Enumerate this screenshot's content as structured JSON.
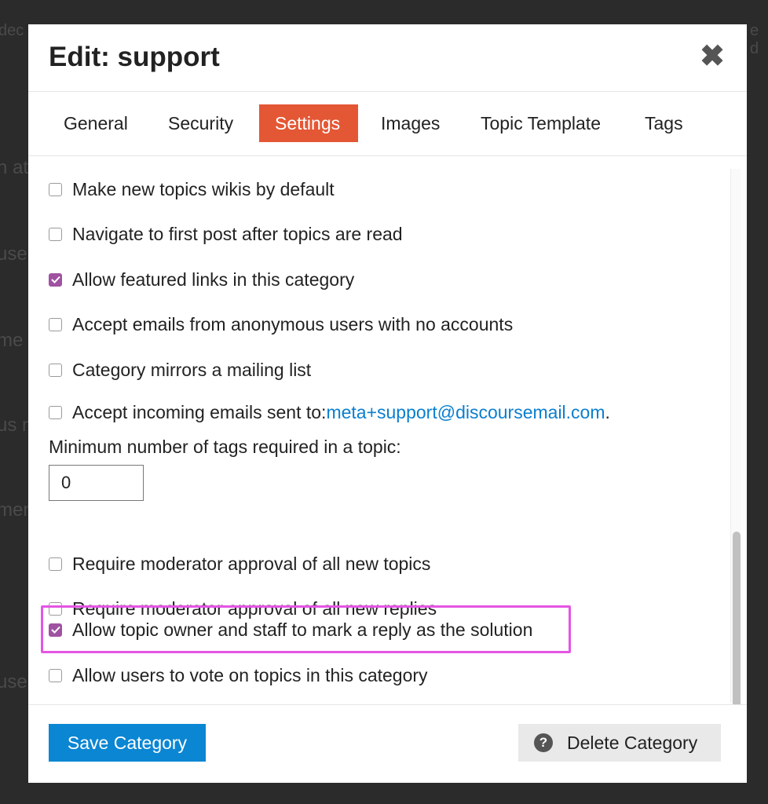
{
  "modal": {
    "title": "Edit: support",
    "close_glyph": "✖"
  },
  "tabs": [
    {
      "label": "General",
      "active": false
    },
    {
      "label": "Security",
      "active": false
    },
    {
      "label": "Settings",
      "active": true
    },
    {
      "label": "Images",
      "active": false
    },
    {
      "label": "Topic Template",
      "active": false
    },
    {
      "label": "Tags",
      "active": false
    }
  ],
  "settings": {
    "options": [
      {
        "label": "Make new topics wikis by default",
        "checked": false
      },
      {
        "label": "Navigate to first post after topics are read",
        "checked": false
      },
      {
        "label": "Allow featured links in this category",
        "checked": true
      },
      {
        "label": "Accept emails from anonymous users with no accounts",
        "checked": false
      },
      {
        "label": "Category mirrors a mailing list",
        "checked": false
      },
      {
        "label": "Accept incoming emails sent to:",
        "checked": false,
        "link": "meta+support@discoursemail.com",
        "suffix": "."
      },
      {
        "label": "Require moderator approval of all new topics",
        "checked": false
      },
      {
        "label": "Require moderator approval of all new replies",
        "checked": false
      },
      {
        "label": "Allow topic owner and staff to mark a reply as the solution",
        "checked": true,
        "highlighted": true
      },
      {
        "label": "Allow users to vote on topics in this category",
        "checked": false
      }
    ],
    "min_tags": {
      "label": "Minimum number of tags required in a topic:",
      "value": "0"
    }
  },
  "footer": {
    "save_label": "Save Category",
    "delete_label": "Delete Category",
    "delete_icon": "?"
  },
  "colors": {
    "active_tab": "#e45735",
    "checkbox_checked": "#a052a2",
    "primary_button": "#0a86d3",
    "link": "#0a7fcf",
    "highlight_border": "#e455e4"
  },
  "backdrop": {
    "fragments": [
      "dec",
      "e d",
      "n at",
      "use",
      "me",
      "us n",
      "men",
      "use"
    ]
  }
}
